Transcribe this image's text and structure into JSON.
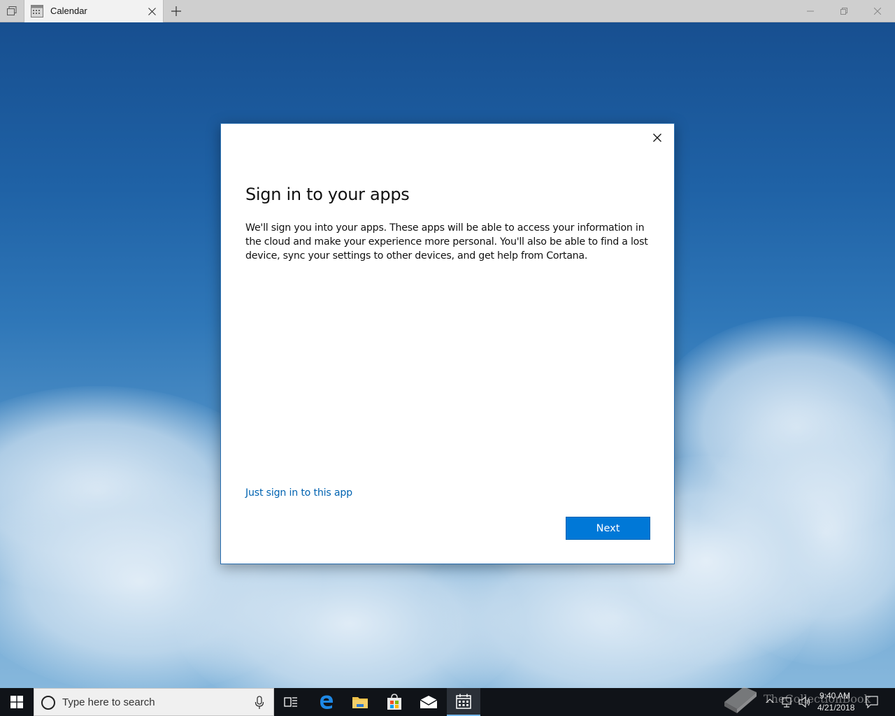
{
  "window": {
    "tab_label": "Calendar",
    "tab_icon": "calendar-icon"
  },
  "dialog": {
    "title": "Sign in to your apps",
    "body": "We'll sign you into your apps. These apps will be able to access your information in the cloud and make your experience more personal. You'll also be able to find a lost device, sync your settings to other devices, and get help from Cortana.",
    "link": "Just sign in to this app",
    "next_label": "Next"
  },
  "taskbar": {
    "search_placeholder": "Type here to search",
    "pinned": [
      "task-view-icon",
      "edge-icon",
      "file-explorer-icon",
      "store-icon",
      "mail-icon",
      "calendar-icon"
    ],
    "active": "calendar-icon",
    "clock_time": "9:40 AM",
    "clock_date": "4/21/2018",
    "watermark": "TheCollectionBook"
  },
  "colors": {
    "accent": "#0078d7",
    "link": "#0063b1",
    "taskbar": "#101318"
  }
}
